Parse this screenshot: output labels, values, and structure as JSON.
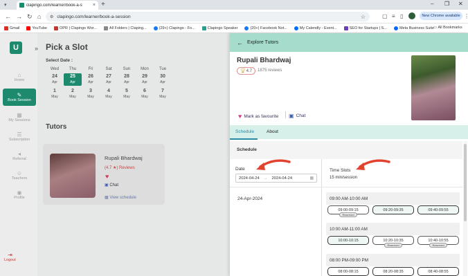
{
  "browser": {
    "tab_title": "clapingo.com/learner/book-a-s",
    "url": "clapingo.com/learner/book-a-session",
    "new_chrome": "New Chrome available",
    "bookmarks": [
      "Gmail",
      "YouTube",
      "OPR | Clapingo Wor...",
      "All Folders | Claping...",
      "(29+) Clapingo - Fo...",
      "Clapingo Speaker",
      "(20+) Facebook Not...",
      "My Calendly - Event...",
      "SEO for Startups | S...",
      "Meta Business Suite"
    ],
    "all_bookmarks": "All Bookmarks"
  },
  "sidebar": {
    "logo": "U",
    "items": [
      {
        "label": "Home",
        "icon": "home-icon"
      },
      {
        "label": "Book Session",
        "icon": "book-icon"
      },
      {
        "label": "My Sessions",
        "icon": "calendar-icon"
      },
      {
        "label": "Subscription",
        "icon": "list-icon"
      },
      {
        "label": "Referral",
        "icon": "megaphone-icon"
      },
      {
        "label": "Teachers",
        "icon": "teachers-icon"
      },
      {
        "label": "Profile",
        "icon": "profile-icon"
      }
    ],
    "logout": "Logout"
  },
  "main": {
    "title": "Pick a Slot",
    "select_date": "Select Date :",
    "days": [
      "Wed",
      "Thu",
      "Fri",
      "Sat",
      "Sun",
      "Mon",
      "Tue"
    ],
    "row1": [
      {
        "d": "24",
        "m": "Apr"
      },
      {
        "d": "25",
        "m": "Apr"
      },
      {
        "d": "26",
        "m": "Apr"
      },
      {
        "d": "27",
        "m": "Apr"
      },
      {
        "d": "28",
        "m": "Apr"
      },
      {
        "d": "29",
        "m": "Apr"
      },
      {
        "d": "30",
        "m": "Apr"
      }
    ],
    "row2": [
      {
        "d": "1",
        "m": "May"
      },
      {
        "d": "2",
        "m": "May"
      },
      {
        "d": "3",
        "m": "May"
      },
      {
        "d": "4",
        "m": "May"
      },
      {
        "d": "5",
        "m": "May"
      },
      {
        "d": "6",
        "m": "May"
      },
      {
        "d": "7",
        "m": "May"
      }
    ],
    "tutors_title": "Tutors",
    "tutor": {
      "name": "Rupali Bhardwaj",
      "rating": "(4.7 ★) Reviews",
      "chat": "Chat",
      "view": "View schedule"
    }
  },
  "panel": {
    "back": "Explore Tutors",
    "name": "Rupali Bhardwaj",
    "rating": "4.7",
    "reviews": "1875 reviews",
    "favourite": "Mark as favourite",
    "chat": "Chat",
    "tabs": [
      "Schedule",
      "About"
    ],
    "schedule_heading": "Schedule",
    "date_label": "Date",
    "date_from": "2024-04-24",
    "date_to": "2024-04-24",
    "time_label": "Time Slots",
    "session": "15 min/session",
    "date_item": "24-Apr-2024",
    "groups": [
      {
        "label": "09:00 AM-10:00 AM",
        "slots": [
          {
            "t": "09:00-09:15",
            "r": "Reserved"
          },
          {
            "t": "09:20-09:35",
            "r": ""
          },
          {
            "t": "09:40-09:55",
            "r": ""
          }
        ]
      },
      {
        "label": "10:00 AM-11:00 AM",
        "slots": [
          {
            "t": "10:00-10:15",
            "r": ""
          },
          {
            "t": "10:20-10:35",
            "r": "Reserved"
          },
          {
            "t": "10:40-10:55",
            "r": "Reserved"
          }
        ]
      },
      {
        "label": "08:00 PM-09:00 PM",
        "slots": [
          {
            "t": "08:00-08:15",
            "r": ""
          },
          {
            "t": "08:20-08:35",
            "r": ""
          },
          {
            "t": "08:40-08:55",
            "r": ""
          }
        ]
      }
    ]
  },
  "colors": {
    "brand": "#1d8a6e",
    "header": "#a6dccb",
    "arrow": "#e2432f"
  }
}
